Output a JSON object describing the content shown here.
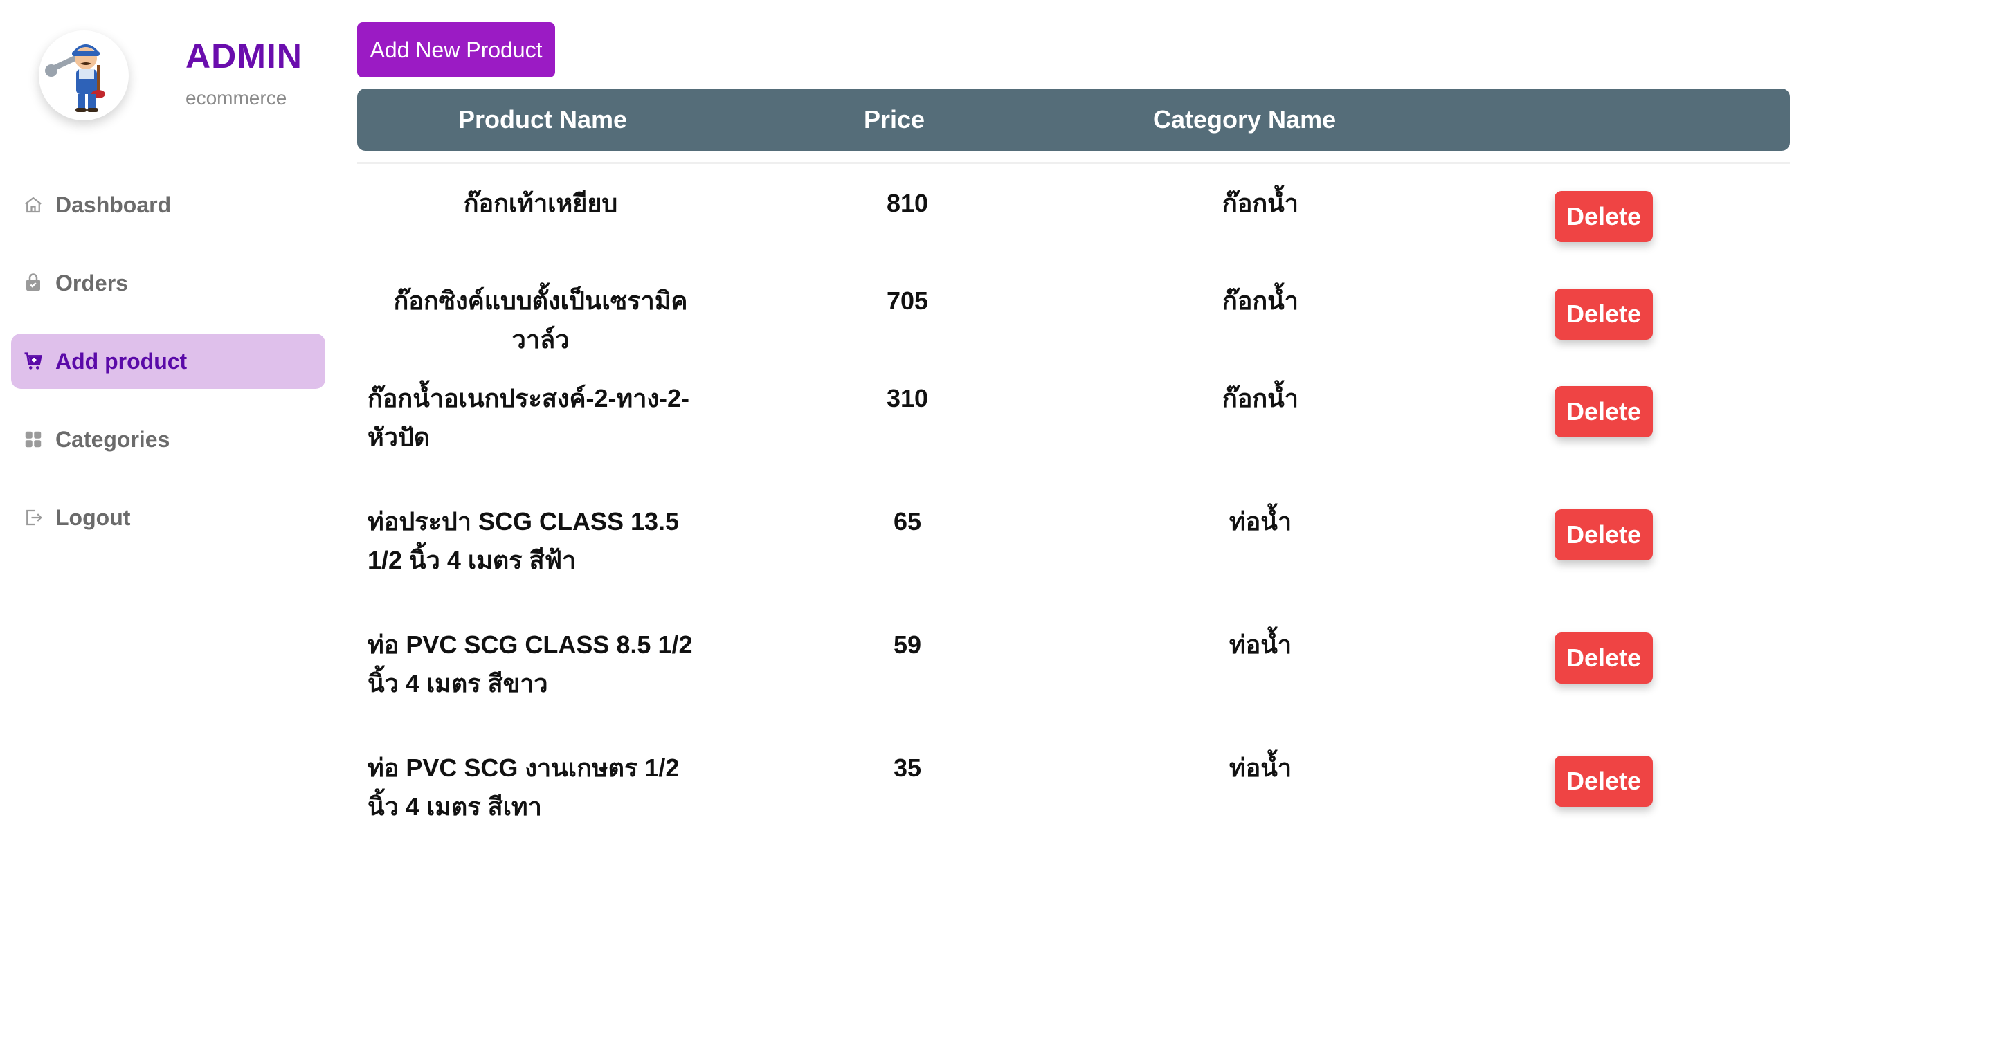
{
  "brand": {
    "title": "ADMIN",
    "subtitle": "ecommerce"
  },
  "nav": [
    {
      "label": "Dashboard",
      "icon": "home-icon",
      "active": false
    },
    {
      "label": "Orders",
      "icon": "bag-icon",
      "active": false
    },
    {
      "label": "Add product",
      "icon": "cart-plus-icon",
      "active": true
    },
    {
      "label": "Categories",
      "icon": "grid-icon",
      "active": false
    },
    {
      "label": "Logout",
      "icon": "logout-icon",
      "active": false
    }
  ],
  "toolbar": {
    "add_label": "Add New Product"
  },
  "table": {
    "headers": [
      "Product Name",
      "Price",
      "Category Name"
    ],
    "rows": [
      {
        "name": "ก๊อกเท้าเหยียบ",
        "price": "810",
        "category": "ก๊อกน้ำ",
        "action": "Delete"
      },
      {
        "name": "ก๊อกซิงค์แบบตั้งเป็นเซรามิควาล์ว",
        "price": "705",
        "category": "ก๊อกน้ำ",
        "action": "Delete"
      },
      {
        "name": "ก๊อกน้ำอเนกประสงค์-2-ทาง-2-หัวปัด",
        "price": "310",
        "category": "ก๊อกน้ำ",
        "action": "Delete"
      },
      {
        "name": "ท่อประปา SCG CLASS 13.5 1/2 นิ้ว 4 เมตร สีฟ้า",
        "price": "65",
        "category": "ท่อน้ำ",
        "action": "Delete"
      },
      {
        "name": "ท่อ PVC SCG CLASS 8.5 1/2 นิ้ว 4 เมตร สีขาว",
        "price": "59",
        "category": "ท่อน้ำ",
        "action": "Delete"
      },
      {
        "name": "ท่อ PVC SCG งานเกษตร 1/2 นิ้ว 4 เมตร สีเทา",
        "price": "35",
        "category": "ท่อน้ำ",
        "action": "Delete"
      }
    ]
  },
  "colors": {
    "accent": "#9b1bc4",
    "brand_text": "#6a0dad",
    "header_bg": "#556d79",
    "active_nav_bg": "#dfc0eb",
    "danger": "#ef4444"
  }
}
